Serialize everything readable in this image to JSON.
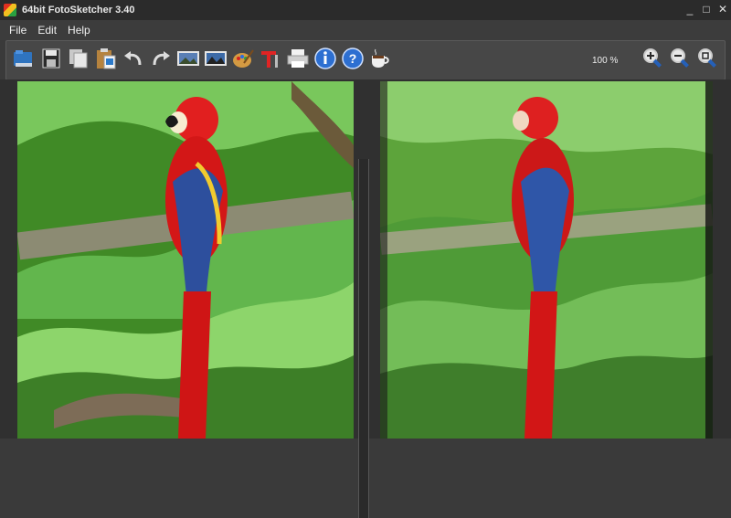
{
  "window": {
    "title": "64bit FotoSketcher 3.40"
  },
  "controls": {
    "minimize": "_",
    "maximize": "□",
    "close": "✕"
  },
  "menu": {
    "items": [
      "File",
      "Edit",
      "Help"
    ]
  },
  "toolbar": {
    "zoom_level": "100 %",
    "buttons": [
      "open-icon",
      "save-icon",
      "copy-icon",
      "paste-icon",
      "undo-icon",
      "redo-icon",
      "original-image-icon",
      "processed-image-icon",
      "palette-icon",
      "text-icon",
      "print-icon",
      "info-icon",
      "help-icon",
      "coffee-icon",
      "zoom-in-icon",
      "zoom-out-icon",
      "zoom-fit-icon"
    ]
  },
  "colors": {
    "titlebar": "#2b2b2b",
    "toolbar": "#474747",
    "parrot_red": "#d81818",
    "parrot_blue": "#2a4fa0",
    "foliage": "#3f8d2a"
  }
}
